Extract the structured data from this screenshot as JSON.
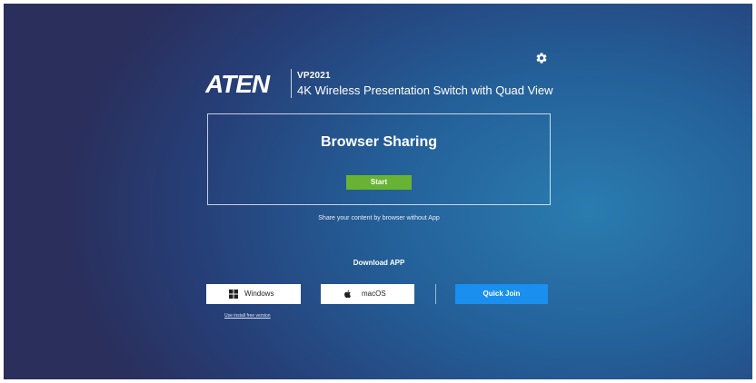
{
  "brand": {
    "logo_text": "ATEN",
    "model": "VP2021",
    "product": "4K Wireless Presentation Switch with Quad View"
  },
  "settings": {
    "icon": "gear-icon"
  },
  "browser_sharing": {
    "title": "Browser Sharing",
    "start_label": "Start",
    "description": "Share your content by browser without App"
  },
  "download": {
    "label": "Download APP",
    "windows_label": "Windows",
    "windows_icon": "windows-icon",
    "macos_label": "macOS",
    "macos_icon": "apple-icon",
    "quick_join_label": "Quick Join",
    "install_free_label": "Use install free version"
  },
  "colors": {
    "background": "#245f98",
    "start_button": "#68b333",
    "quick_join_button": "#1a8ff0"
  }
}
